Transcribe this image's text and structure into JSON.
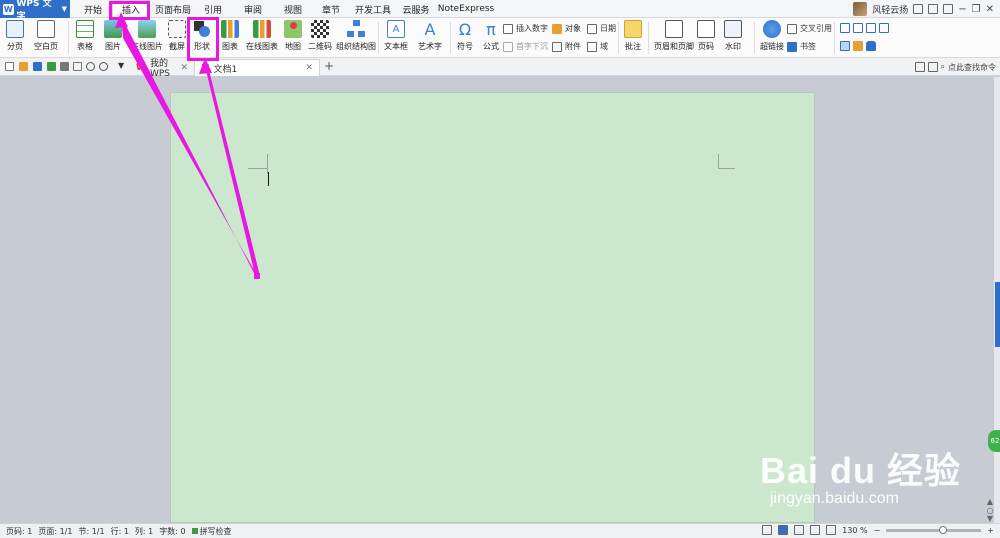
{
  "app": {
    "name": "WPS 文字",
    "logo": "W"
  },
  "menu_tabs": [
    "开始",
    "插入",
    "页面布局",
    "引用",
    "审阅",
    "视图",
    "章节",
    "开发工具",
    "云服务",
    "NoteExpress"
  ],
  "active_tab": "插入",
  "user": {
    "name": "风轻云扬"
  },
  "ribbon": {
    "page_break": "分页",
    "blank_page": "空白页",
    "table": "表格",
    "picture": "图片",
    "online_picture": "在线图片",
    "screenshot": "截屏",
    "shape": "形状",
    "chart": "图表",
    "online_chart": "在线图表",
    "map": "地图",
    "qrcode": "二维码",
    "org_chart": "组织结构图",
    "textbox": "文本框",
    "wordart": "艺术字",
    "symbol": "符号",
    "formula": "公式",
    "insert_number": "插入数字",
    "object": "对象",
    "date": "日期",
    "drop_cap": "首字下沉",
    "attachment": "附件",
    "field": "域",
    "comment": "批注",
    "header_footer": "页眉和页脚",
    "page_number": "页码",
    "watermark": "水印",
    "hyperlink": "超链接",
    "cross_ref": "交叉引用",
    "bookmark": "书签"
  },
  "doc_tabs": [
    {
      "label": "我的WPS"
    },
    {
      "label": "文档1"
    }
  ],
  "search_command": "点此查找命令",
  "status": {
    "page_no": "页码: 1",
    "pages": "页面: 1/1",
    "section": "节: 1/1",
    "row": "行: 1",
    "col": "列: 1",
    "words": "字数: 0",
    "spell": "拼写检查",
    "zoom": "130 %"
  },
  "side_badge": "62",
  "watermark": {
    "brand": "Bai du 经验",
    "url": "jingyan.baidu.com"
  },
  "colors": {
    "accent": "#2f6fc9",
    "highlight": "#e818e0",
    "page": "#cbe8cf"
  }
}
